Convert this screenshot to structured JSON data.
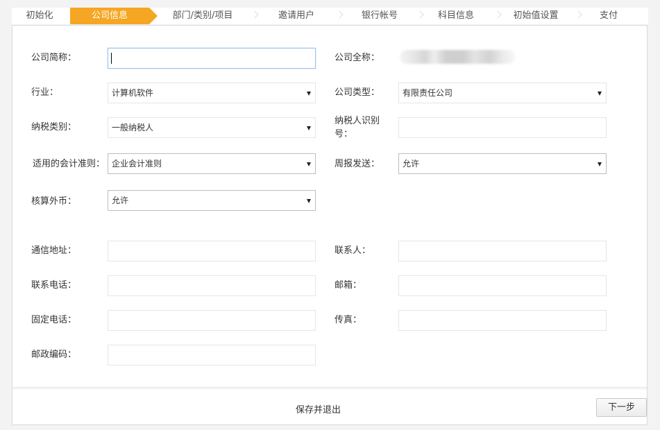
{
  "steps": [
    {
      "label": "初始化",
      "active": false
    },
    {
      "label": "公司信息",
      "active": true
    },
    {
      "label": "部门/类别/项目",
      "active": false
    },
    {
      "label": "邀请用户",
      "active": false
    },
    {
      "label": "银行帐号",
      "active": false
    },
    {
      "label": "科目信息",
      "active": false
    },
    {
      "label": "初始值设置",
      "active": false
    },
    {
      "label": "支付",
      "active": false
    }
  ],
  "form": {
    "short_name": {
      "label": "公司简称：",
      "value": ""
    },
    "full_name": {
      "label": "公司全称：",
      "value": ""
    },
    "industry": {
      "label": "行业：",
      "selected": "计算机软件"
    },
    "company_type": {
      "label": "公司类型：",
      "selected": "有限责任公司"
    },
    "taxpayer_type": {
      "label": "纳税类别：",
      "selected": "一般纳税人"
    },
    "taxpayer_id": {
      "label_line1": "纳税人识别",
      "label_line2": "号：",
      "value": ""
    },
    "accounting_standard": {
      "label": "适用的会计准则：",
      "selected": "企业会计准则"
    },
    "weekly_report": {
      "label": "周报发送：",
      "selected": "允许"
    },
    "foreign_currency": {
      "label": "核算外币：",
      "selected": "允许"
    },
    "address": {
      "label": "通信地址：",
      "value": ""
    },
    "contact": {
      "label": "联系人：",
      "value": ""
    },
    "phone": {
      "label": "联系电话：",
      "value": ""
    },
    "email": {
      "label": "邮箱：",
      "value": ""
    },
    "landline": {
      "label": "固定电话：",
      "value": ""
    },
    "fax": {
      "label": "传真：",
      "value": ""
    },
    "postcode": {
      "label": "邮政编码：",
      "value": ""
    }
  },
  "footer": {
    "save_exit": "保存并退出",
    "next": "下一步"
  },
  "colors": {
    "active_step": "#f5a623",
    "focus_border": "#9cc3f0"
  }
}
